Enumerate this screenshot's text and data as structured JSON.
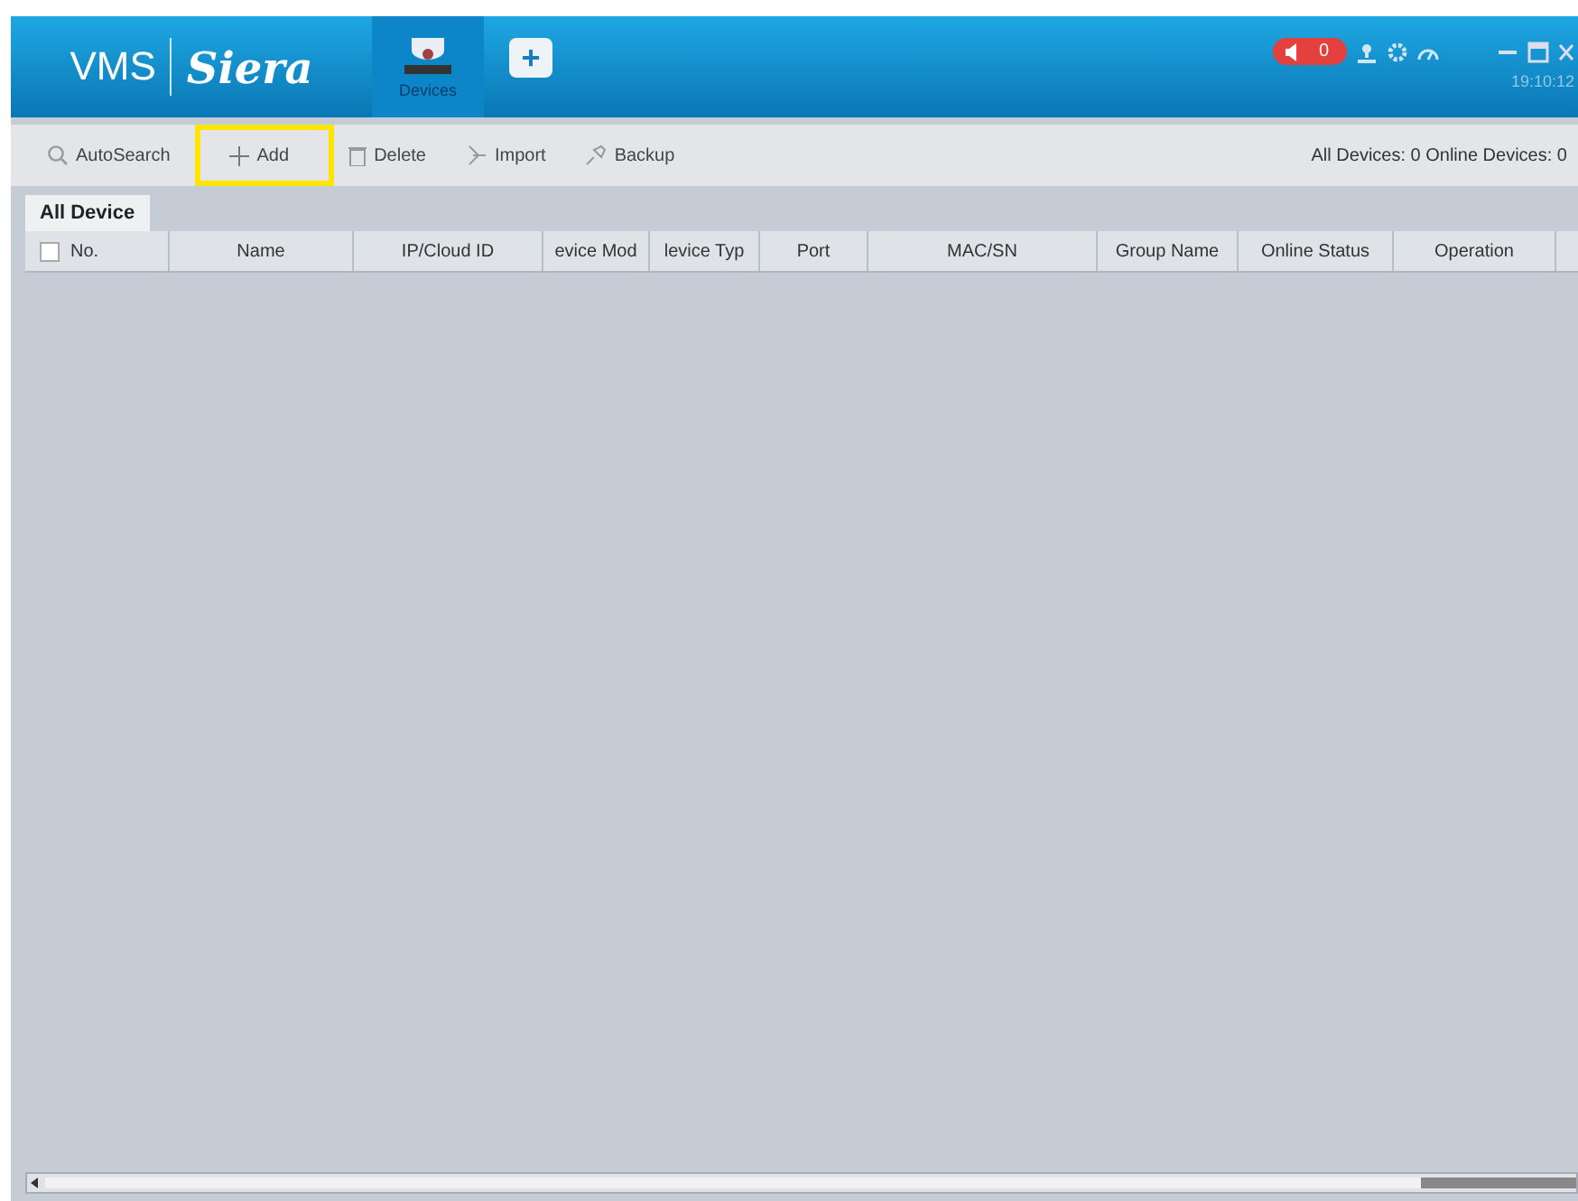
{
  "header": {
    "logo_text": "VMS",
    "brand": "Siera",
    "tabs": [
      {
        "label": "Devices",
        "kind": "devices",
        "selected": true
      },
      {
        "label": "+",
        "kind": "add",
        "selected": false
      }
    ],
    "alarm_count": "0",
    "clock": "19:10:12"
  },
  "toolbar": {
    "buttons": [
      {
        "label": "AutoSearch",
        "kind": "search",
        "highlighted": false
      },
      {
        "label": "Add",
        "kind": "plus",
        "highlighted": true
      },
      {
        "label": "Delete",
        "kind": "trash",
        "highlighted": false
      },
      {
        "label": "Import",
        "kind": "import",
        "highlighted": false
      },
      {
        "label": "Backup",
        "kind": "backup",
        "highlighted": false
      }
    ],
    "summary": "All Devices: 0 Online Devices: 0"
  },
  "list_tabs": [
    {
      "label": "All Device",
      "selected": true
    }
  ],
  "table": {
    "select_all_checked": false,
    "columns": [
      "No.",
      "Name",
      "IP/Cloud ID",
      "evice Mod",
      "levice Typ",
      "Port",
      "MAC/SN",
      "Group Name",
      "Online Status",
      "Operation"
    ]
  }
}
